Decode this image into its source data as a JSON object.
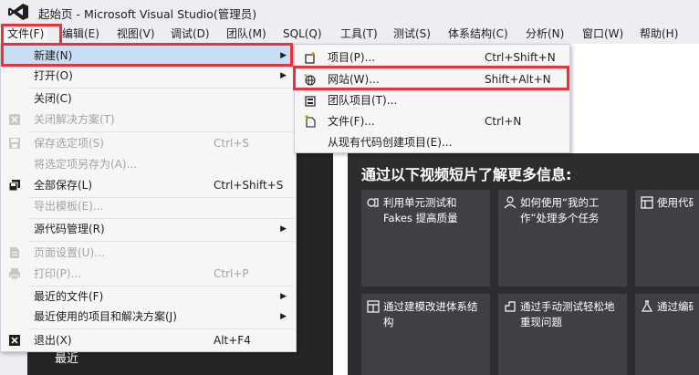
{
  "window": {
    "title": "起始页 - Microsoft Visual Studio(管理员)"
  },
  "menubar": {
    "items": [
      "文件(F)",
      "编辑(E)",
      "视图(V)",
      "调试(D)",
      "团队(M)",
      "SQL(Q)",
      "工具(T)",
      "测试(S)",
      "体系结构(C)",
      "分析(N)",
      "窗口(W)",
      "帮助(H)"
    ]
  },
  "file_menu": {
    "items": [
      {
        "label": "新建(N)",
        "shortcut": "",
        "submenu": true,
        "disabled": false
      },
      {
        "label": "打开(O)",
        "shortcut": "",
        "submenu": true,
        "disabled": false
      },
      {
        "label": "关闭(C)",
        "shortcut": "",
        "submenu": false,
        "disabled": false
      },
      {
        "label": "关闭解决方案(T)",
        "shortcut": "",
        "submenu": false,
        "disabled": true
      },
      {
        "label": "保存选定项(S)",
        "shortcut": "Ctrl+S",
        "submenu": false,
        "disabled": true
      },
      {
        "label": "将选定项另存为(A)...",
        "shortcut": "",
        "submenu": false,
        "disabled": true
      },
      {
        "label": "全部保存(L)",
        "shortcut": "Ctrl+Shift+S",
        "submenu": false,
        "disabled": false
      },
      {
        "label": "导出模板(E)...",
        "shortcut": "",
        "submenu": false,
        "disabled": true
      },
      {
        "label": "源代码管理(R)",
        "shortcut": "",
        "submenu": true,
        "disabled": false
      },
      {
        "label": "页面设置(U)...",
        "shortcut": "",
        "submenu": false,
        "disabled": true
      },
      {
        "label": "打印(P)...",
        "shortcut": "Ctrl+P",
        "submenu": false,
        "disabled": true
      },
      {
        "label": "最近的文件(F)",
        "shortcut": "",
        "submenu": true,
        "disabled": false
      },
      {
        "label": "最近使用的项目和解决方案(J)",
        "shortcut": "",
        "submenu": true,
        "disabled": false
      },
      {
        "label": "退出(X)",
        "shortcut": "Alt+F4",
        "submenu": false,
        "disabled": false
      }
    ]
  },
  "new_menu": {
    "items": [
      {
        "label": "项目(P)...",
        "shortcut": "Ctrl+Shift+N"
      },
      {
        "label": "网站(W)...",
        "shortcut": "Shift+Alt+N"
      },
      {
        "label": "团队项目(T)...",
        "shortcut": ""
      },
      {
        "label": "文件(F)...",
        "shortcut": "Ctrl+N"
      },
      {
        "label": "从现有代码创建项目(E)...",
        "shortcut": ""
      }
    ]
  },
  "start_page": {
    "video_title": "通过以下视频短片了解更多信息:",
    "tiles": [
      "利用单元测试和 Fakes 提高质量",
      "如何使用“我的工作”处理多个任务",
      "使用代码图理解代码",
      "通过建模改进体系结构",
      "通过手动测试轻松地重现问题",
      "通过编码的UI测试轻松测试"
    ],
    "recent_label": "最近"
  },
  "colors": {
    "highlight": "#e8323c",
    "menu_hover": "#c9def5",
    "vs_purple": "#68217a"
  }
}
